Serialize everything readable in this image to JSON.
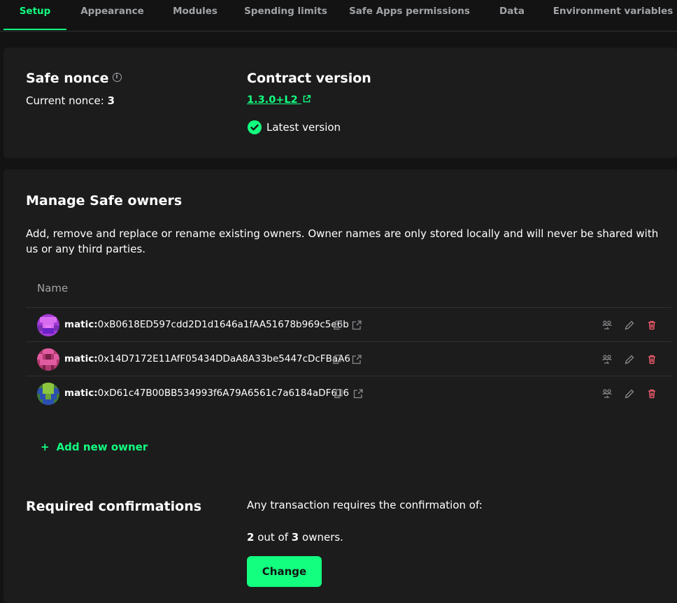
{
  "tabs": [
    {
      "label": "Setup",
      "active": true
    },
    {
      "label": "Appearance"
    },
    {
      "label": "Modules"
    },
    {
      "label": "Spending limits"
    },
    {
      "label": "Safe Apps permissions"
    },
    {
      "label": "Data"
    },
    {
      "label": "Environment variables"
    }
  ],
  "nonce": {
    "title": "Safe nonce",
    "label": "Current nonce:",
    "value": "3"
  },
  "contract": {
    "title": "Contract version",
    "version": "1.3.0+L2",
    "status": "Latest version"
  },
  "owners": {
    "title": "Manage Safe owners",
    "description": "Add, remove and replace or rename existing owners. Owner names are only stored locally and will never be shared with us or any third parties.",
    "column_name": "Name",
    "list": [
      {
        "prefix": "matic:",
        "address": "0xB0618ED597cdd2D1d1646a1fAA51678b969c5e6b"
      },
      {
        "prefix": "matic:",
        "address": "0x14D7172E11AfF05434DDaA8A33be5447cDcFBaA6"
      },
      {
        "prefix": "matic:",
        "address": "0xD61c47B00BB534993f6A79A6561c7a6184aDF616"
      }
    ],
    "add_label": "Add new owner"
  },
  "confirmations": {
    "title": "Required confirmations",
    "intro": "Any transaction requires the confirmation of:",
    "required": "2",
    "out_of": "out of",
    "total": "3",
    "suffix": "owners.",
    "button": "Change"
  },
  "colors": {
    "accent": "#12ff80",
    "danger": "#ff5f72",
    "background": "#121312",
    "card": "#1c1c1c"
  }
}
